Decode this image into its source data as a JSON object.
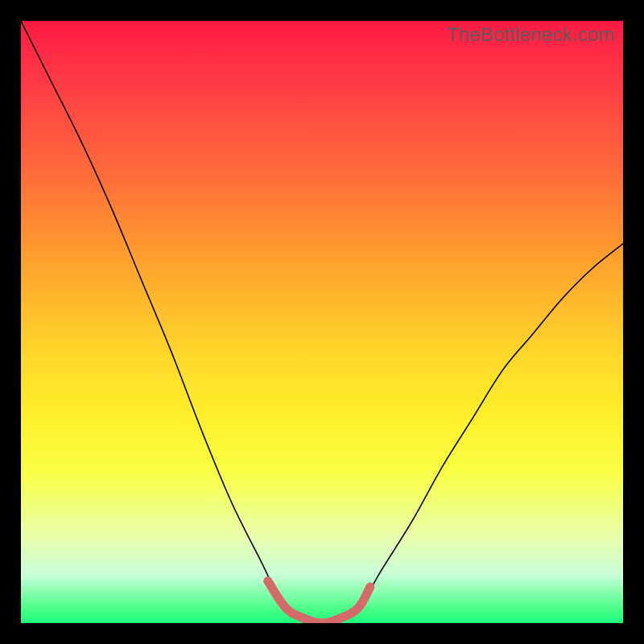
{
  "watermark": "TheBottleneck.com",
  "chart_data": {
    "type": "line",
    "title": "",
    "xlabel": "",
    "ylabel": "",
    "xlim": [
      0,
      100
    ],
    "ylim": [
      0,
      100
    ],
    "grid": false,
    "series": [
      {
        "name": "bottleneck-curve",
        "x": [
          0,
          5,
          10,
          15,
          20,
          25,
          30,
          35,
          40,
          43,
          46,
          50,
          54,
          57,
          60,
          65,
          70,
          75,
          80,
          85,
          90,
          95,
          100
        ],
        "y": [
          100,
          90,
          80,
          69,
          57,
          45,
          32,
          20,
          10,
          4,
          1,
          0,
          1,
          4,
          9,
          17,
          26,
          34,
          42,
          48,
          54,
          59,
          63
        ]
      }
    ],
    "highlight": {
      "name": "optimal-range",
      "x": [
        41,
        44,
        47,
        50,
        53,
        56,
        58
      ],
      "y": [
        7,
        2.5,
        0.8,
        0,
        0.8,
        2.5,
        6
      ]
    },
    "background_gradient": {
      "top": "#ff1a44",
      "mid": "#ffee2a",
      "bottom": "#1aff7e"
    }
  }
}
